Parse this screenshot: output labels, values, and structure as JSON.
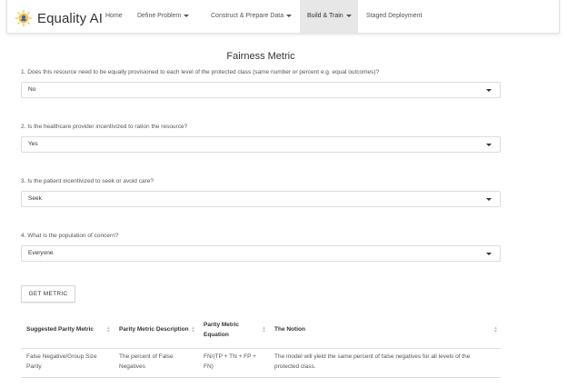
{
  "app": {
    "brand": "Equality AI",
    "logo_icon": "scales-of-justice-icon",
    "nav": [
      {
        "label": "Home",
        "dropdown": false
      },
      {
        "label": "Define Problem",
        "dropdown": true
      },
      {
        "label": "Construct & Prepare Data",
        "dropdown": true
      },
      {
        "label": "Build & Train",
        "dropdown": true,
        "active": true
      },
      {
        "label": "Staged Deployment",
        "dropdown": false
      }
    ]
  },
  "main": {
    "title": "Fairness Metric",
    "questions": [
      {
        "text": "1. Does this resource need to be equally provisioned to each level of the protected class (same number or percent e.g. equal outcomes)?",
        "value": "No"
      },
      {
        "text": "2. Is the healthcare provider incentivized to ration the resource?",
        "value": "Yes"
      },
      {
        "text": "3. Is the patient incentivized to seek or avoid care?",
        "value": "Seek"
      },
      {
        "text": "4. What is the population of concern?",
        "value": "Everyone"
      }
    ],
    "button_label": "GET METRIC",
    "table": {
      "headers": [
        "Suggested Parity Metric",
        "Parity Metric Description",
        "Parity Metric Equation",
        "The Notion"
      ],
      "rows": [
        [
          "False Negative/Group Size Parity",
          "The percent of False Negatives",
          "FN/(TP + TN + FP + FN)",
          "The model will yield the same percent of false negatives for all levels of the protected class."
        ]
      ]
    }
  }
}
